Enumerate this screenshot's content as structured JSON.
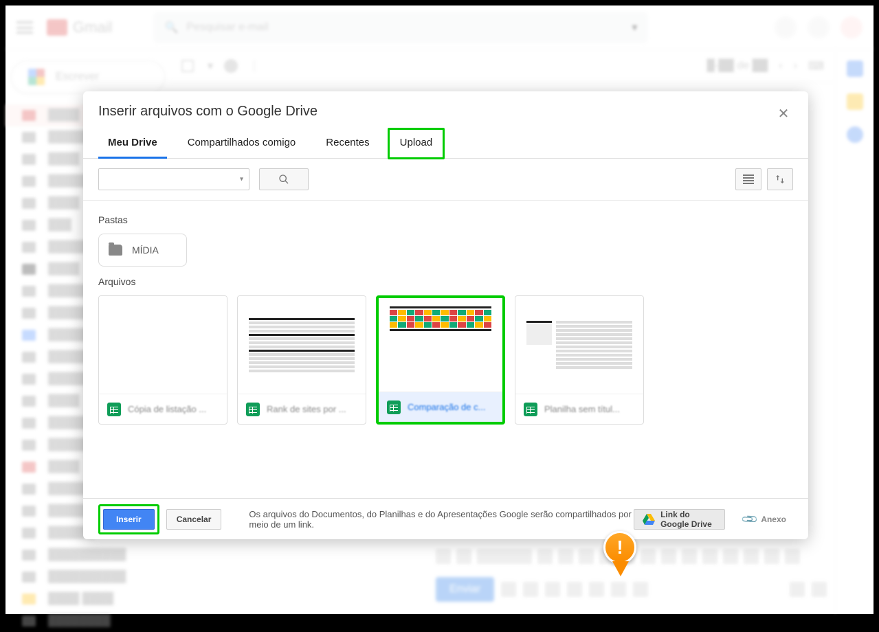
{
  "gmail": {
    "product": "Gmail",
    "search_placeholder": "Pesquisar e-mail",
    "compose_label": "Escrever",
    "send_label": "Enviar"
  },
  "modal": {
    "title": "Inserir arquivos com o Google Drive",
    "tabs": [
      {
        "id": "my-drive",
        "label": "Meu Drive",
        "active": true
      },
      {
        "id": "shared",
        "label": "Compartilhados comigo"
      },
      {
        "id": "recent",
        "label": "Recentes"
      },
      {
        "id": "upload",
        "label": "Upload",
        "highlighted": true
      }
    ],
    "sections": {
      "folders_label": "Pastas",
      "files_label": "Arquivos",
      "folders": [
        {
          "name": "MÍDIA"
        }
      ],
      "files": [
        {
          "name": "Cópia de listação ...",
          "type": "sheets",
          "preview": "blank"
        },
        {
          "name": "Rank de sites por ...",
          "type": "sheets",
          "preview": "table"
        },
        {
          "name": "Comparação de c...",
          "type": "sheets",
          "preview": "colorful",
          "selected": true
        },
        {
          "name": "Planilha sem títul...",
          "type": "sheets",
          "preview": "list"
        }
      ]
    },
    "footer": {
      "insert": "Inserir",
      "cancel": "Cancelar",
      "message": "Os arquivos do Documentos, do Planilhas e do Apresentações Google serão compartilhados por meio de um link.",
      "drive_link": "Link do Google Drive",
      "attachment": "Anexo"
    }
  }
}
